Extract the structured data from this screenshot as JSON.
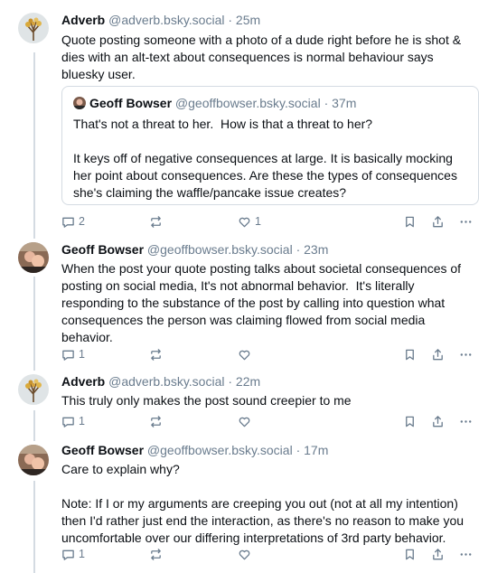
{
  "posts": [
    {
      "author": "Adverb",
      "handle": "@adverb.bsky.social",
      "time": "25m",
      "text": "Quote posting someone with a photo of a dude right before he is shot & dies with an alt-text about consequences is normal behaviour says bluesky user.",
      "avatar_icon": "tree-avatar",
      "quote": {
        "author": "Geoff Bowser",
        "handle": "@geoffbowser.bsky.social",
        "time": "37m",
        "text": "That's not a threat to her.  How is that a threat to her?\n\nIt keys off of negative consequences at large. It is basically mocking her point about consequences. Are these the types of consequences she's claiming the waffle/pancake issue creates?"
      },
      "reply_count": "2",
      "like_count": "1"
    },
    {
      "author": "Geoff Bowser",
      "handle": "@geoffbowser.bsky.social",
      "time": "23m",
      "text": "When the post your quote posting talks about societal consequences of posting on social media, It's not abnormal behavior.  It's literally responding to the substance of the post by calling into question what consequences the person was claiming flowed from social media behavior.",
      "avatar_icon": "selfie-avatar",
      "reply_count": "1",
      "like_count": ""
    },
    {
      "author": "Adverb",
      "handle": "@adverb.bsky.social",
      "time": "22m",
      "text": "This truly only makes the post sound creepier to me",
      "avatar_icon": "tree-avatar",
      "reply_count": "1",
      "like_count": ""
    },
    {
      "author": "Geoff Bowser",
      "handle": "@geoffbowser.bsky.social",
      "time": "17m",
      "text": "Care to explain why?\n\nNote: If I or my arguments are creeping you out (not at all my intention) then I'd rather just end the interaction, as there's no reason to make you uncomfortable over our differing interpretations of 3rd party behavior.",
      "avatar_icon": "selfie-avatar",
      "reply_count": "1",
      "like_count": ""
    }
  ],
  "separator": " · ",
  "colors": {
    "text": "#0b0f14",
    "muted": "#6a7c8e",
    "border": "#d4dbe2"
  }
}
